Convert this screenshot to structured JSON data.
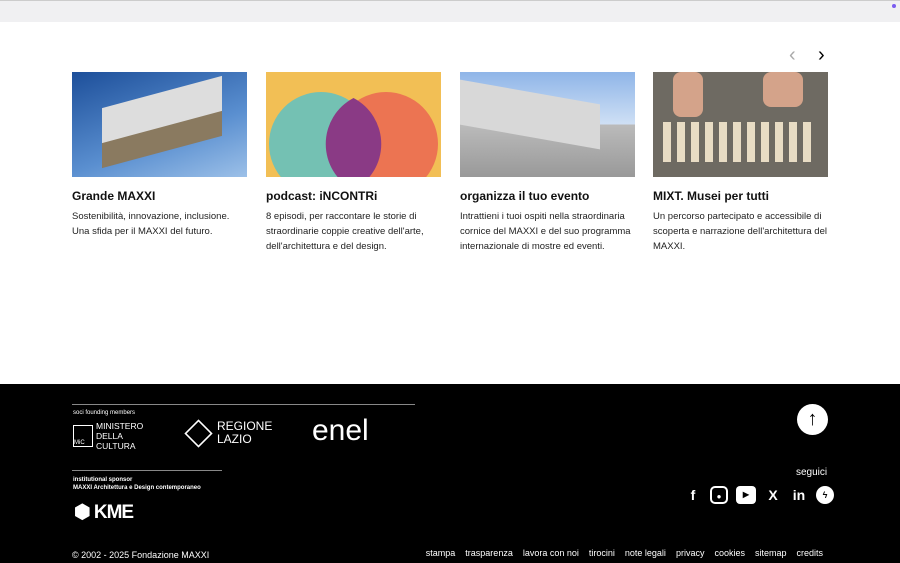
{
  "nav": {
    "prev": "‹",
    "next": "›"
  },
  "cards": [
    {
      "title": "Grande MAXXI",
      "text": "Sostenibilità, innovazione, inclusione. Una sfida per il MAXXI del futuro."
    },
    {
      "title": "podcast: iNCONTRi",
      "text": "8 episodi, per raccontare le storie di straordinarie coppie creative dell'arte, dell'architettura e del design."
    },
    {
      "title": "organizza il tuo evento",
      "text": "Intrattieni i tuoi ospiti nella straordinaria cornice del MAXXI e del suo programma internazionale di mostre ed eventi."
    },
    {
      "title": "MIXT. Musei per tutti",
      "text": "Un percorso partecipato e accessibile di scoperta e narrazione dell'architettura del MAXXI."
    }
  ],
  "footer": {
    "founding_label": "soci founding members",
    "logos": [
      "MINISTERO DELLA CULTURA",
      "REGIONE LAZIO",
      "enel",
      "KME"
    ],
    "mic": "MiC",
    "sponsor_label": "institutional sponsor",
    "sponsor_sub": "MAXXI Architettura e Design contemporaneo",
    "seguici": "seguici",
    "copyright": "© 2002 - 2025 Fondazione MAXXI",
    "links": [
      "stampa",
      "trasparenza",
      "lavora con noi",
      "tirocini",
      "note legali",
      "privacy",
      "cookies",
      "sitemap",
      "credits"
    ]
  }
}
